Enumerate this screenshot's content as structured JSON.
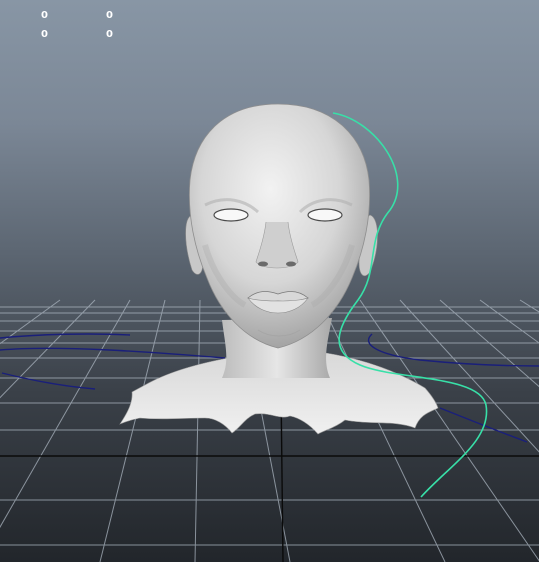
{
  "viewport": {
    "hud": {
      "row1": [
        "0",
        "0"
      ],
      "row2": [
        "0",
        "0"
      ]
    },
    "colors": {
      "background_top": "#8896a5",
      "background_bottom": "#22262b",
      "grid_lines": "#aab4bf",
      "grid_axis": "#0a0a0a",
      "model_surface": "#d9d9d9",
      "curve_selected": "#38e0a8",
      "curve_unselected": "#1a1f7a"
    },
    "scene": {
      "model": "head-bust-mesh",
      "curves": [
        "selected-nurbs-curve",
        "unselected-curve"
      ]
    }
  }
}
